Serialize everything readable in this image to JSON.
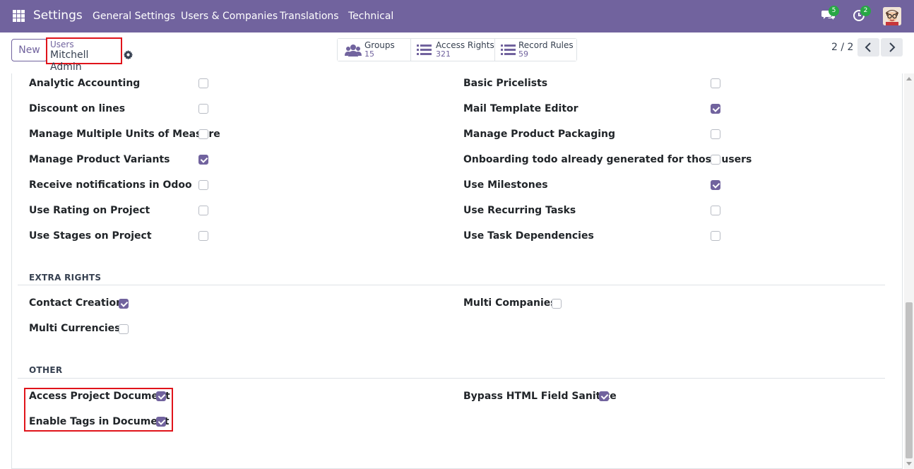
{
  "navbar": {
    "brand": "Settings",
    "menu": [
      "General Settings",
      "Users & Companies",
      "Translations",
      "Technical"
    ],
    "messages_count": "5",
    "activities_count": "2"
  },
  "control_panel": {
    "new_label": "New",
    "breadcrumb_parent": "Users",
    "breadcrumb_current": "Mitchell Admin",
    "stats": [
      {
        "label": "Groups",
        "value": "15",
        "icon": "users-icon"
      },
      {
        "label": "Access Rights",
        "value": "321",
        "icon": "list-icon"
      },
      {
        "label": "Record Rules",
        "value": "59",
        "icon": "list-icon"
      }
    ],
    "pager": "2 / 2"
  },
  "rights": {
    "left": [
      {
        "label": "Analytic Accounting",
        "checked": false
      },
      {
        "label": "Discount on lines",
        "checked": false
      },
      {
        "label": "Manage Multiple Units of Measure",
        "checked": false
      },
      {
        "label": "Manage Product Variants",
        "checked": true
      },
      {
        "label": "Receive notifications in Odoo",
        "checked": false
      },
      {
        "label": "Use Rating on Project",
        "checked": false
      },
      {
        "label": "Use Stages on Project",
        "checked": false
      }
    ],
    "right": [
      {
        "label": "Basic Pricelists",
        "checked": false
      },
      {
        "label": "Mail Template Editor",
        "checked": true
      },
      {
        "label": "Manage Product Packaging",
        "checked": false
      },
      {
        "label": "Onboarding todo already generated for those users",
        "checked": false
      },
      {
        "label": "Use Milestones",
        "checked": true
      },
      {
        "label": "Use Recurring Tasks",
        "checked": false
      },
      {
        "label": "Use Task Dependencies",
        "checked": false
      }
    ]
  },
  "extra_rights": {
    "title": "EXTRA RIGHTS",
    "items": [
      {
        "label": "Contact Creation",
        "checked": true
      },
      {
        "label": "Multi Companies",
        "checked": false
      },
      {
        "label": "Multi Currencies",
        "checked": false
      }
    ]
  },
  "other": {
    "title": "OTHER",
    "items": [
      {
        "label": "Access Project Document",
        "checked": true
      },
      {
        "label": "Bypass HTML Field Sanitize",
        "checked": true
      },
      {
        "label": "Enable Tags in Document",
        "checked": true
      }
    ]
  },
  "colors": {
    "navbar": "#71639e",
    "accent": "#71639e",
    "highlight": "#e0141a",
    "badge": "#28a745"
  }
}
